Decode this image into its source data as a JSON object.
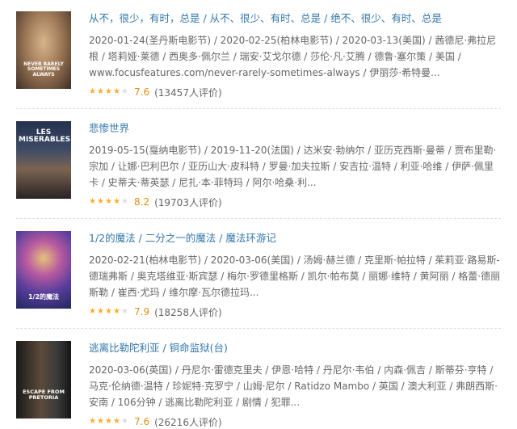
{
  "results": [
    {
      "title": "从不，很少，有时，总是 / 从不、很少、有时、总是 / 绝不、很少、有时、总是",
      "meta": "2020-01-24(圣丹斯电影节) / 2020-02-25(柏林电影节) / 2020-03-13(美国) / 茜德尼·弗拉尼根 / 塔莉娅·莱德 / 西奥多·佩尔兰 / 瑞安·艾戈尔德 / 莎伦·凡·艾腾 / 德鲁·塞尔策 / 美国 / www.focusfeatures.com/never-rarely-sometimes-always / 伊丽莎·希特曼...",
      "stars_filled": 4,
      "score": "7.6",
      "count": "(13457人评价)",
      "poster_caption": "NEVER RARELY SOMETIMES ALWAYS",
      "poster_colors": [
        "#c9a27a",
        "#8a6a4e",
        "#3f2f25"
      ]
    },
    {
      "title": "悲惨世界",
      "meta": "2019-05-15(戛纳电影节) / 2019-11-20(法国) / 达米安·勃纳尔 / 亚历克西斯·曼蒂 / 贾布里勒·宗加 / 让娜·巴利巴尔 / 亚历山大·皮科特 / 罗曼·加夫拉斯 / 安吉拉·温特 / 利亚·哈维 / 伊萨·佩里卡 / 史蒂夫·蒂英瑟 / 尼扎·本·菲特玛 / 阿尔·哈桑·利...",
      "stars_filled": 4,
      "score": "8.2",
      "count": "(19703人评价)",
      "poster_caption": "LES MISERABLES",
      "poster_colors": [
        "#2b3a55",
        "#6b5b4b",
        "#1e1e22"
      ]
    },
    {
      "title": "1/2的魔法 / 二分之一的魔法 / 魔法环游记",
      "meta": "2020-02-21(柏林电影节) / 2020-03-06(美国) / 汤姆·赫兰德 / 克里斯·帕拉特 / 茱莉亚·路易斯-德瑞弗斯 / 奥克塔维亚·斯宾瑟 / 梅尔·罗德里格斯 / 凯尔·帕布莫 / 丽娜·维特 / 黄阿丽 / 格蕾·德丽斯勒 / 崔西·尤玛 / 维尔摩·瓦尔德拉玛...",
      "stars_filled": 4,
      "score": "7.9",
      "count": "(18258人评价)",
      "poster_caption": "1/2的魔法",
      "poster_colors": [
        "#5a3f9c",
        "#2a2f7a",
        "#c85a9c"
      ]
    },
    {
      "title": "逃离比勒陀利亚 / 铜命监狱(台)",
      "meta": "2020-03-06(英国) / 丹尼尔·雷德克里夫 / 伊恩·哈特 / 丹尼尔·韦伯 / 内森·佩吉 / 斯蒂芬·亨特 / 马克·伦纳德·温特 / 珍妮特·克罗宁 / 山姆·尼尔 / Ratidzo Mambo / 英国 / 澳大利亚 / 弗朗西斯·安南 / 106分钟 / 逃离比勒陀利亚 / 剧情 / 犯罪...",
      "stars_filled": 4,
      "score": "7.6",
      "count": "(26216人评价)",
      "poster_caption": "ESCAPE FROM PRETORIA",
      "poster_colors": [
        "#3a3a3a",
        "#5c4a3a",
        "#1a1a1a"
      ]
    }
  ]
}
